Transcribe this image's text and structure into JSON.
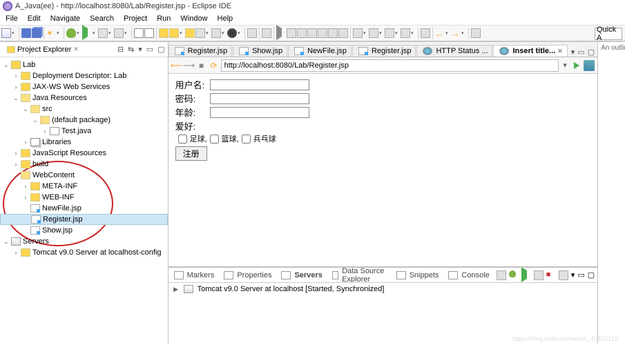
{
  "title": "A_Java(ee) - http://localhost:8080/Lab/Register.jsp - Eclipse IDE",
  "menu": [
    "File",
    "Edit",
    "Navigate",
    "Search",
    "Project",
    "Run",
    "Window",
    "Help"
  ],
  "quick": "Quick A",
  "explorer": {
    "title": "Project Explorer",
    "actions_tooltip": [
      "Collapse",
      "Link",
      "Menu",
      "Min",
      "Max"
    ],
    "tree": [
      {
        "d": 0,
        "t": "v",
        "i": "ti-proj",
        "l": "Lab"
      },
      {
        "d": 1,
        "t": ">",
        "i": "ti-folder",
        "l": "Deployment Descriptor: Lab"
      },
      {
        "d": 1,
        "t": ">",
        "i": "ti-folder",
        "l": "JAX-WS Web Services"
      },
      {
        "d": 1,
        "t": "v",
        "i": "ti-folder-open",
        "l": "Java Resources"
      },
      {
        "d": 2,
        "t": "v",
        "i": "ti-folder-open",
        "l": "src"
      },
      {
        "d": 3,
        "t": "v",
        "i": "ti-folder-open",
        "l": "(default package)"
      },
      {
        "d": 4,
        "t": ">",
        "i": "ti-file",
        "l": "Test.java"
      },
      {
        "d": 2,
        "t": ">",
        "i": "ti-lib",
        "l": "Libraries"
      },
      {
        "d": 1,
        "t": ">",
        "i": "ti-folder",
        "l": "JavaScript Resources"
      },
      {
        "d": 1,
        "t": ">",
        "i": "ti-folder",
        "l": "build"
      },
      {
        "d": 1,
        "t": "v",
        "i": "ti-folder-open",
        "l": "WebContent"
      },
      {
        "d": 2,
        "t": ">",
        "i": "ti-folder",
        "l": "META-INF"
      },
      {
        "d": 2,
        "t": ">",
        "i": "ti-folder",
        "l": "WEB-INF"
      },
      {
        "d": 2,
        "t": "",
        "i": "ti-jsp",
        "l": "NewFile.jsp"
      },
      {
        "d": 2,
        "t": "",
        "i": "ti-jsp",
        "l": "Register.jsp",
        "sel": true
      },
      {
        "d": 2,
        "t": "",
        "i": "ti-jsp",
        "l": "Show.jsp"
      },
      {
        "d": 0,
        "t": "v",
        "i": "ti-server",
        "l": "Servers"
      },
      {
        "d": 1,
        "t": ">",
        "i": "ti-folder",
        "l": "Tomcat v9.0 Server at localhost-config"
      }
    ]
  },
  "tabs": [
    {
      "l": "Register.jsp",
      "i": "ti-jsp"
    },
    {
      "l": "Show.jsp",
      "i": "ti-jsp"
    },
    {
      "l": "NewFile.jsp",
      "i": "ti-jsp"
    },
    {
      "l": "Register.jsp",
      "i": "ti-jsp"
    },
    {
      "l": "HTTP Status ...",
      "i": "ti-file",
      "globe": true
    },
    {
      "l": "Insert title...",
      "i": "ti-file",
      "globe": true,
      "active": true
    }
  ],
  "url": "http://localhost:8080/Lab/Register.jsp",
  "form": {
    "username_lbl": "用户名:",
    "password_lbl": "密码:",
    "age_lbl": "年龄:",
    "hobby_lbl": "爱好:",
    "cb": [
      "足球,",
      "篮球,",
      "兵乓球"
    ],
    "submit": "注册"
  },
  "bottom": {
    "tabs": [
      "Markers",
      "Properties",
      "Servers",
      "Data Source Explorer",
      "Snippets",
      "Console"
    ],
    "active_idx": 2,
    "server_line": "Tomcat v9.0 Server at localhost  [Started, Synchronized]"
  },
  "outline": "An outlin",
  "watermark": "https://blog.csdn.net/weixin_45873215"
}
